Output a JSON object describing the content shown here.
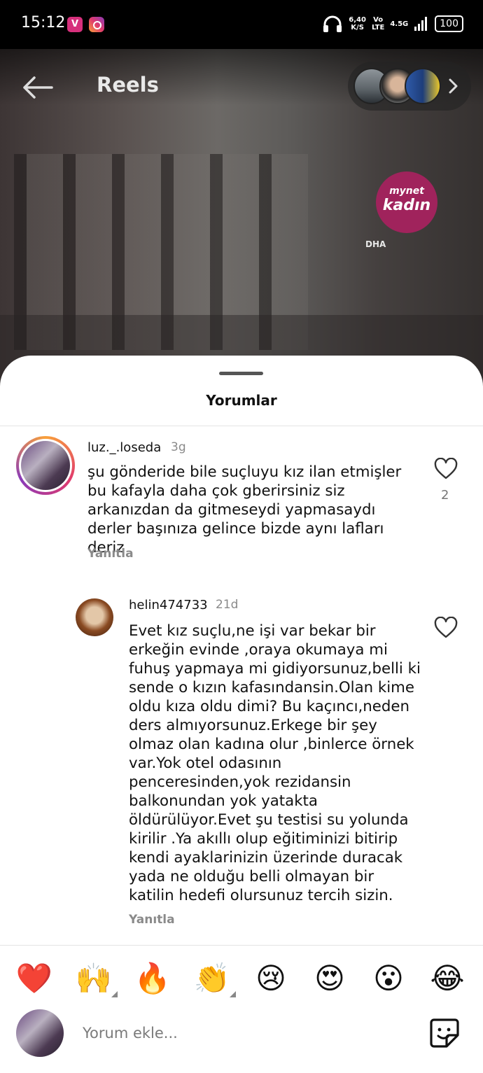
{
  "status_bar": {
    "time": "15:12",
    "net_speed": "6,40",
    "net_unit": "K/S",
    "volte_top": "Vo",
    "volte_bottom": "LTE",
    "network": "4.5G",
    "battery": "100"
  },
  "header": {
    "title": "Reels",
    "watermark_top": "mynet",
    "watermark_bottom": "kadın",
    "source_mark": "DHA"
  },
  "sheet": {
    "title": "Yorumlar"
  },
  "comments": [
    {
      "username": "luz._.loseda",
      "age": "3g",
      "text": "şu gönderide bile suçluyu kız ilan etmişler bu kafayla daha çok gberirsiniz siz arkanızdan da gitmeseydi yapmasaydı derler başınıza gelince bizde aynı lafları deriz",
      "reply_label": "Yanıtla",
      "likes": "2"
    },
    {
      "username": "helin474733",
      "age": "21d",
      "text": "Evet kız suçlu,ne işi var bekar bir erkeğin evinde ,oraya okumaya mi fuhuş yapmaya mi gidiyorsunuz,belli ki sende o kızın kafasındansin.Olan kime oldu kıza oldu dimi? Bu kaçıncı,neden ders almıyorsunuz.Erkege bir şey olmaz olan kadına olur ,binlerce örnek var.Yok otel odasının penceresinden,yok rezidansin balkonundan yok yatakta öldürülüyor.Evet şu testisi su yolunda kirilir .Ya akıllı olup eğitiminizi bitirip kendi ayaklarinizin üzerinde duracak yada ne olduğu belli olmayan bir katilin hedefi olursunuz tercih sizin.",
      "reply_label": "Yanıtla"
    }
  ],
  "emoji_bar": [
    "❤️",
    "🙌",
    "🔥",
    "👏",
    "😢",
    "😍",
    "😮",
    "😂"
  ],
  "composer": {
    "placeholder": "Yorum ekle..."
  }
}
